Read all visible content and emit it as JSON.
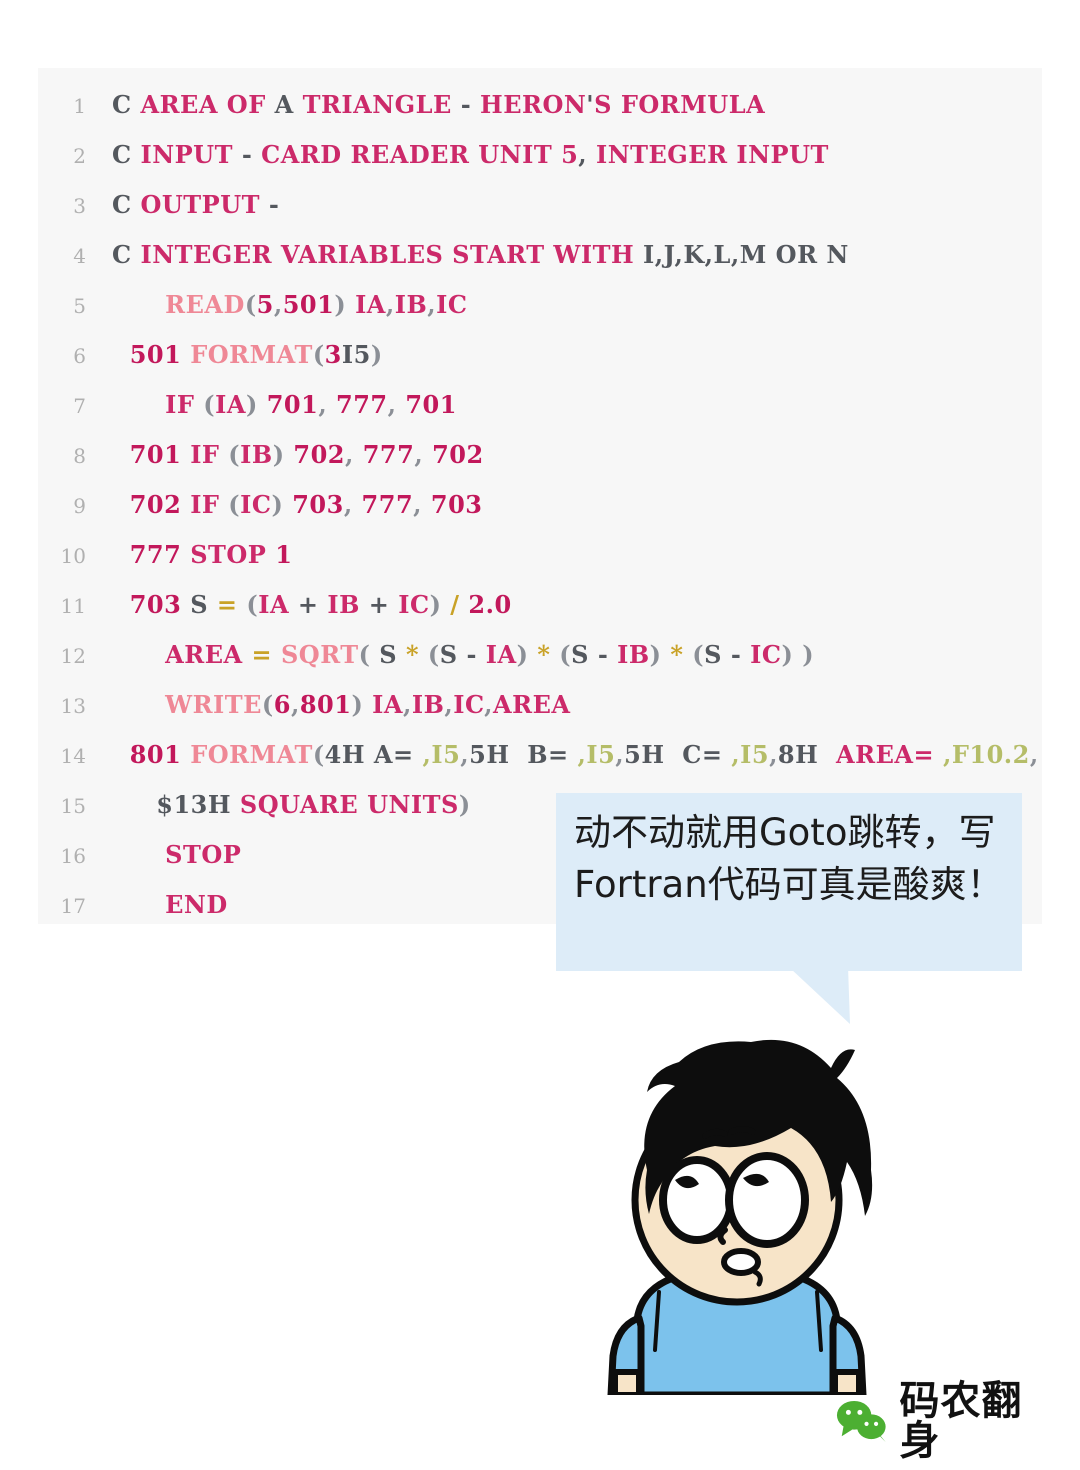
{
  "code_block": {
    "language": "Fortran",
    "background": "#f7f7f7",
    "lines": [
      {
        "n": "1",
        "tokens": [
          {
            "t": "C",
            "c": "plain"
          },
          {
            "t": " AREA OF",
            "c": "cmt"
          },
          {
            "t": " A ",
            "c": "plain"
          },
          {
            "t": "TRIANGLE",
            "c": "cmt"
          },
          {
            "t": " - ",
            "c": "plain"
          },
          {
            "t": "HERON",
            "c": "cmt"
          },
          {
            "t": "'",
            "c": "plain"
          },
          {
            "t": "S FORMULA",
            "c": "cmt"
          }
        ]
      },
      {
        "n": "2",
        "tokens": [
          {
            "t": "C",
            "c": "plain"
          },
          {
            "t": " INPUT",
            "c": "cmt"
          },
          {
            "t": " - ",
            "c": "plain"
          },
          {
            "t": "CARD READER UNIT ",
            "c": "cmt"
          },
          {
            "t": "5",
            "c": "cmt"
          },
          {
            "t": ",",
            "c": "plain"
          },
          {
            "t": " INTEGER INPUT",
            "c": "cmt"
          }
        ]
      },
      {
        "n": "3",
        "tokens": [
          {
            "t": "C",
            "c": "plain"
          },
          {
            "t": " OUTPUT",
            "c": "cmt"
          },
          {
            "t": " -",
            "c": "plain"
          }
        ]
      },
      {
        "n": "4",
        "tokens": [
          {
            "t": "C",
            "c": "plain"
          },
          {
            "t": " INTEGER VARIABLES START WITH",
            "c": "cmt"
          },
          {
            "t": " I,J,K,L,M OR N",
            "c": "plain"
          }
        ]
      },
      {
        "n": "5",
        "tokens": [
          {
            "t": "      ",
            "c": "plain"
          },
          {
            "t": "READ",
            "c": "kw"
          },
          {
            "t": "(",
            "c": "punc"
          },
          {
            "t": "5",
            "c": "num"
          },
          {
            "t": ",",
            "c": "punc"
          },
          {
            "t": "501",
            "c": "num"
          },
          {
            "t": ")",
            "c": "punc"
          },
          {
            "t": " ",
            "c": "plain"
          },
          {
            "t": "IA",
            "c": "id"
          },
          {
            "t": ",",
            "c": "punc"
          },
          {
            "t": "IB",
            "c": "id"
          },
          {
            "t": ",",
            "c": "punc"
          },
          {
            "t": "IC",
            "c": "id"
          }
        ]
      },
      {
        "n": "6",
        "tokens": [
          {
            "t": "  ",
            "c": "plain"
          },
          {
            "t": "501",
            "c": "num"
          },
          {
            "t": " ",
            "c": "plain"
          },
          {
            "t": "FORMAT",
            "c": "kw"
          },
          {
            "t": "(",
            "c": "punc"
          },
          {
            "t": "3",
            "c": "num"
          },
          {
            "t": "I5",
            "c": "plain"
          },
          {
            "t": ")",
            "c": "punc"
          }
        ]
      },
      {
        "n": "7",
        "tokens": [
          {
            "t": "      ",
            "c": "plain"
          },
          {
            "t": "IF",
            "c": "id"
          },
          {
            "t": " (",
            "c": "punc"
          },
          {
            "t": "IA",
            "c": "id"
          },
          {
            "t": ") ",
            "c": "punc"
          },
          {
            "t": "701",
            "c": "num"
          },
          {
            "t": ", ",
            "c": "punc"
          },
          {
            "t": "777",
            "c": "num"
          },
          {
            "t": ", ",
            "c": "punc"
          },
          {
            "t": "701",
            "c": "num"
          }
        ]
      },
      {
        "n": "8",
        "tokens": [
          {
            "t": "  ",
            "c": "plain"
          },
          {
            "t": "701",
            "c": "num"
          },
          {
            "t": " ",
            "c": "plain"
          },
          {
            "t": "IF",
            "c": "id"
          },
          {
            "t": " (",
            "c": "punc"
          },
          {
            "t": "IB",
            "c": "id"
          },
          {
            "t": ") ",
            "c": "punc"
          },
          {
            "t": "702",
            "c": "num"
          },
          {
            "t": ", ",
            "c": "punc"
          },
          {
            "t": "777",
            "c": "num"
          },
          {
            "t": ", ",
            "c": "punc"
          },
          {
            "t": "702",
            "c": "num"
          }
        ]
      },
      {
        "n": "9",
        "tokens": [
          {
            "t": "  ",
            "c": "plain"
          },
          {
            "t": "702",
            "c": "num"
          },
          {
            "t": " ",
            "c": "plain"
          },
          {
            "t": "IF",
            "c": "id"
          },
          {
            "t": " (",
            "c": "punc"
          },
          {
            "t": "IC",
            "c": "id"
          },
          {
            "t": ") ",
            "c": "punc"
          },
          {
            "t": "703",
            "c": "num"
          },
          {
            "t": ", ",
            "c": "punc"
          },
          {
            "t": "777",
            "c": "num"
          },
          {
            "t": ", ",
            "c": "punc"
          },
          {
            "t": "703",
            "c": "num"
          }
        ]
      },
      {
        "n": "10",
        "tokens": [
          {
            "t": "  ",
            "c": "plain"
          },
          {
            "t": "777",
            "c": "num"
          },
          {
            "t": " ",
            "c": "plain"
          },
          {
            "t": "STOP",
            "c": "id"
          },
          {
            "t": " ",
            "c": "plain"
          },
          {
            "t": "1",
            "c": "num"
          }
        ]
      },
      {
        "n": "11",
        "tokens": [
          {
            "t": "  ",
            "c": "plain"
          },
          {
            "t": "703",
            "c": "num"
          },
          {
            "t": " ",
            "c": "plain"
          },
          {
            "t": "S",
            "c": "plain"
          },
          {
            "t": " = ",
            "c": "op"
          },
          {
            "t": "(",
            "c": "punc"
          },
          {
            "t": "IA",
            "c": "id"
          },
          {
            "t": " + ",
            "c": "plain"
          },
          {
            "t": "IB",
            "c": "id"
          },
          {
            "t": " + ",
            "c": "plain"
          },
          {
            "t": "IC",
            "c": "id"
          },
          {
            "t": ")",
            "c": "punc"
          },
          {
            "t": " / ",
            "c": "op"
          },
          {
            "t": "2.0",
            "c": "num"
          }
        ]
      },
      {
        "n": "12",
        "tokens": [
          {
            "t": "      ",
            "c": "plain"
          },
          {
            "t": "AREA",
            "c": "id"
          },
          {
            "t": " = ",
            "c": "op"
          },
          {
            "t": "SQRT",
            "c": "kw"
          },
          {
            "t": "( ",
            "c": "punc"
          },
          {
            "t": "S",
            "c": "plain"
          },
          {
            "t": " * ",
            "c": "op"
          },
          {
            "t": "(",
            "c": "punc"
          },
          {
            "t": "S",
            "c": "plain"
          },
          {
            "t": " - ",
            "c": "plain"
          },
          {
            "t": "IA",
            "c": "id"
          },
          {
            "t": ") ",
            "c": "punc"
          },
          {
            "t": "* ",
            "c": "op"
          },
          {
            "t": "(",
            "c": "punc"
          },
          {
            "t": "S",
            "c": "plain"
          },
          {
            "t": " - ",
            "c": "plain"
          },
          {
            "t": "IB",
            "c": "id"
          },
          {
            "t": ") ",
            "c": "punc"
          },
          {
            "t": "* ",
            "c": "op"
          },
          {
            "t": "(",
            "c": "punc"
          },
          {
            "t": "S",
            "c": "plain"
          },
          {
            "t": " - ",
            "c": "plain"
          },
          {
            "t": "IC",
            "c": "id"
          },
          {
            "t": ") )",
            "c": "punc"
          }
        ]
      },
      {
        "n": "13",
        "tokens": [
          {
            "t": "      ",
            "c": "plain"
          },
          {
            "t": "WRITE",
            "c": "kw"
          },
          {
            "t": "(",
            "c": "punc"
          },
          {
            "t": "6",
            "c": "num"
          },
          {
            "t": ",",
            "c": "punc"
          },
          {
            "t": "801",
            "c": "num"
          },
          {
            "t": ")",
            "c": "punc"
          },
          {
            "t": " ",
            "c": "plain"
          },
          {
            "t": "IA",
            "c": "id"
          },
          {
            "t": ",",
            "c": "punc"
          },
          {
            "t": "IB",
            "c": "id"
          },
          {
            "t": ",",
            "c": "punc"
          },
          {
            "t": "IC",
            "c": "id"
          },
          {
            "t": ",",
            "c": "punc"
          },
          {
            "t": "AREA",
            "c": "id"
          }
        ]
      },
      {
        "n": "14",
        "tokens": [
          {
            "t": "  ",
            "c": "plain"
          },
          {
            "t": "801",
            "c": "num"
          },
          {
            "t": " ",
            "c": "plain"
          },
          {
            "t": "FORMAT",
            "c": "kw"
          },
          {
            "t": "(",
            "c": "punc"
          },
          {
            "t": "4H A=",
            "c": "plain"
          },
          {
            "t": " ",
            "c": "plain"
          },
          {
            "t": ",I5",
            "c": "fmt"
          },
          {
            "t": ",",
            "c": "punc"
          },
          {
            "t": "5H  B=",
            "c": "plain"
          },
          {
            "t": " ",
            "c": "plain"
          },
          {
            "t": ",I5",
            "c": "fmt"
          },
          {
            "t": ",",
            "c": "punc"
          },
          {
            "t": "5H  C=",
            "c": "plain"
          },
          {
            "t": " ",
            "c": "plain"
          },
          {
            "t": ",I5",
            "c": "fmt"
          },
          {
            "t": ",",
            "c": "punc"
          },
          {
            "t": "8H  ",
            "c": "plain"
          },
          {
            "t": "AREA=",
            "c": "id"
          },
          {
            "t": " ",
            "c": "plain"
          },
          {
            "t": ",F10.2",
            "c": "fmt"
          },
          {
            "t": ",",
            "c": "punc"
          }
        ]
      },
      {
        "n": "15",
        "tokens": [
          {
            "t": "     ",
            "c": "plain"
          },
          {
            "t": "$13H ",
            "c": "plain"
          },
          {
            "t": "SQUARE UNITS",
            "c": "id"
          },
          {
            "t": ")",
            "c": "punc"
          }
        ]
      },
      {
        "n": "16",
        "tokens": [
          {
            "t": "      ",
            "c": "plain"
          },
          {
            "t": "STOP",
            "c": "id"
          }
        ]
      },
      {
        "n": "17",
        "tokens": [
          {
            "t": "      ",
            "c": "plain"
          },
          {
            "t": "END",
            "c": "id"
          }
        ]
      }
    ]
  },
  "speech_bubble": {
    "text": "动不动就用Goto跳转，写Fortran代码可真是酸爽！",
    "background": "#ddecf8",
    "text_color": "#1c1c1c"
  },
  "character": {
    "description": "cartoon-boy-confused",
    "hair_color": "#0d0d0d",
    "skin_color": "#f7e4c8",
    "shirt_color": "#7cc2ec"
  },
  "watermark": {
    "text": "码农翻身",
    "icon": "wechat-icon",
    "icon_color": "#4caf32",
    "text_color": "#111111"
  },
  "colors": {
    "page_background": "#ffffff",
    "code_background": "#f7f7f7",
    "comment": "#cc2a6a",
    "keyword": "#ef8896",
    "number": "#c2185b",
    "identifier": "#cc2a6a",
    "punctuation": "#8b8f96",
    "operator": "#c9a227",
    "format_spec": "#b5bd68",
    "line_number": "#b0b0b0",
    "bubble": "#ddecf8"
  }
}
